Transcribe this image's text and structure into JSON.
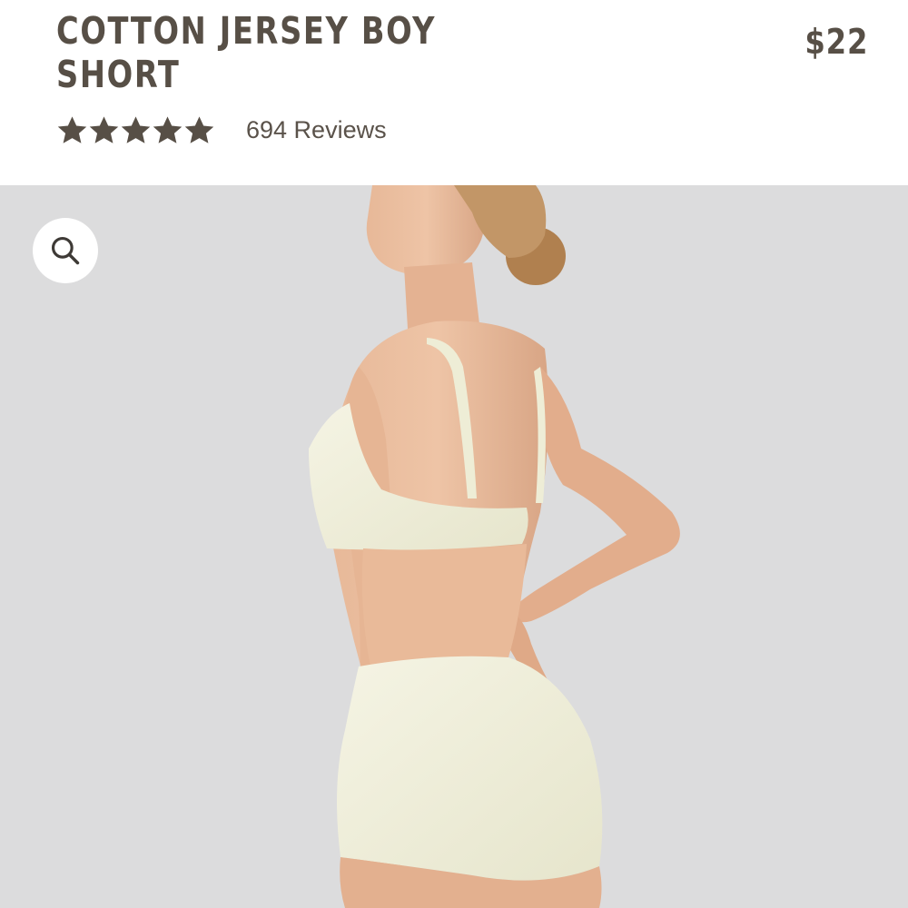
{
  "product": {
    "title": "COTTON JERSEY BOY\nSHORT",
    "price": "$22",
    "rating": {
      "value": 5,
      "max": 5,
      "reviews_label": "694 Reviews"
    }
  },
  "gallery": {
    "zoom_icon": "search-icon",
    "image_subject": "model-wearing-cream-bra-and-boy-short"
  },
  "colors": {
    "text": "#574f46",
    "star": "#574f46",
    "image_background": "#dcdcdd",
    "garment": "#f1f0dc"
  }
}
